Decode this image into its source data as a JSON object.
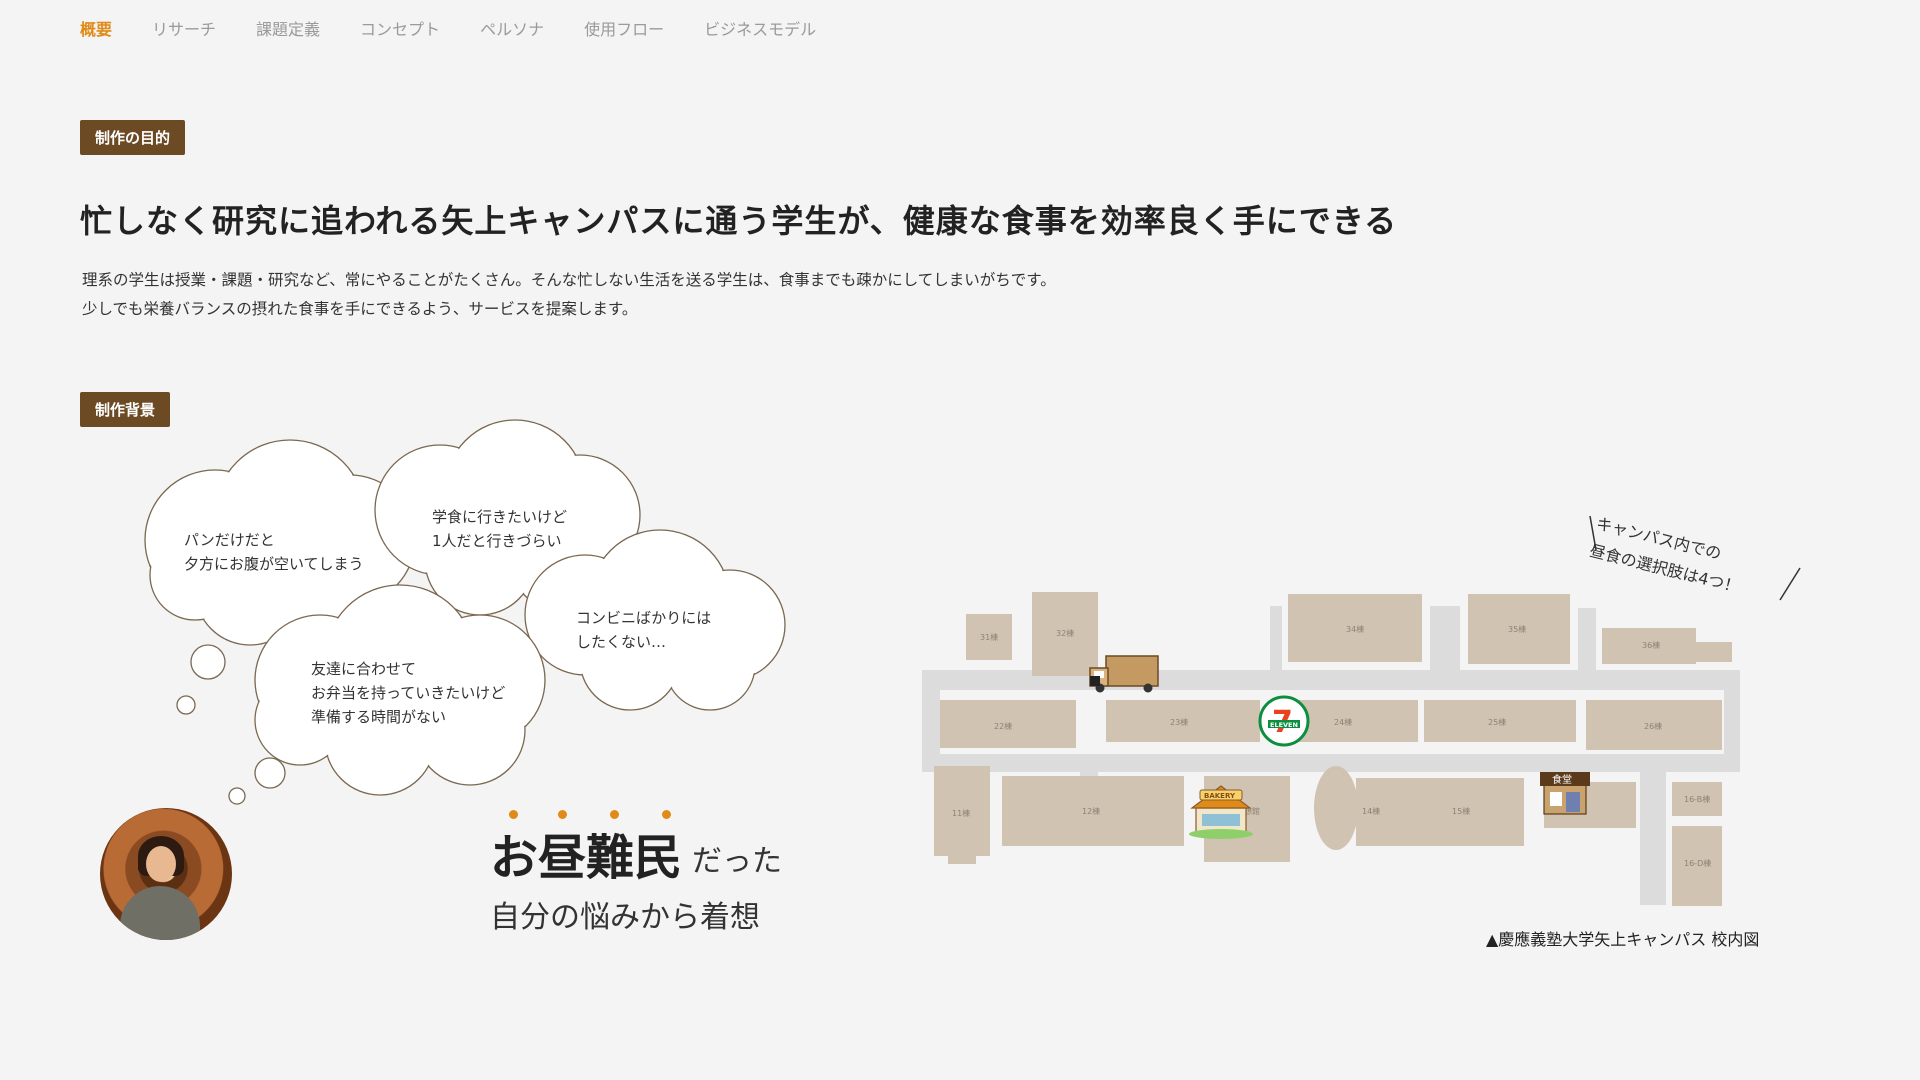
{
  "nav": {
    "items": [
      {
        "label": "概要",
        "active": true
      },
      {
        "label": "リサーチ"
      },
      {
        "label": "課題定義"
      },
      {
        "label": "コンセプト"
      },
      {
        "label": "ペルソナ"
      },
      {
        "label": "使用フロー"
      },
      {
        "label": "ビジネスモデル"
      }
    ]
  },
  "purpose": {
    "badge": "制作の目的",
    "headline": "忙しなく研究に追われる矢上キャンパスに通う学生が、健康な食事を効率良く手にできる",
    "desc_line1": "理系の学生は授業・課題・研究など、常にやることがたくさん。そんな忙しない生活を送る学生は、食事までも疎かにしてしまいがちです。",
    "desc_line2": "少しでも栄養バランスの摂れた食事を手にできるよう、サービスを提案します。"
  },
  "background": {
    "badge": "制作背景",
    "clouds": [
      {
        "line1": "パンだけだと",
        "line2": "夕方にお腹が空いてしまう"
      },
      {
        "line1": "学食に行きたいけど",
        "line2": "1人だと行きづらい"
      },
      {
        "line1": "コンビニばかりには",
        "line2": "したくない…"
      },
      {
        "line1": "友達に合わせて",
        "line2": "お弁当を持っていきたいけど",
        "line3": "準備する時間がない"
      }
    ],
    "catch_main": "お昼難民",
    "catch_suffix": "だった",
    "catch_sub": "自分の悩みから着想"
  },
  "map": {
    "note_line1": "キャンパス内での",
    "note_line2": "昼食の選択肢は4つ！",
    "caption": "▲慶應義塾大学矢上キャンパス 校内図",
    "buildings": [
      "31棟",
      "32棟",
      "34棟",
      "35棟",
      "36棟",
      "22棟",
      "23棟",
      "24棟",
      "25棟",
      "26棟",
      "11棟",
      "12棟",
      "創想館",
      "14棟",
      "15棟",
      "16-B棟",
      "16-D棟"
    ],
    "icons": {
      "seven": "ELEVEN",
      "bakery": "BAKERY",
      "cafeteria": "食堂"
    },
    "colors": {
      "building": "#d1c3b2",
      "road": "#dcdcdc",
      "brand": "#6b4a24",
      "accent": "#e08a17"
    }
  }
}
